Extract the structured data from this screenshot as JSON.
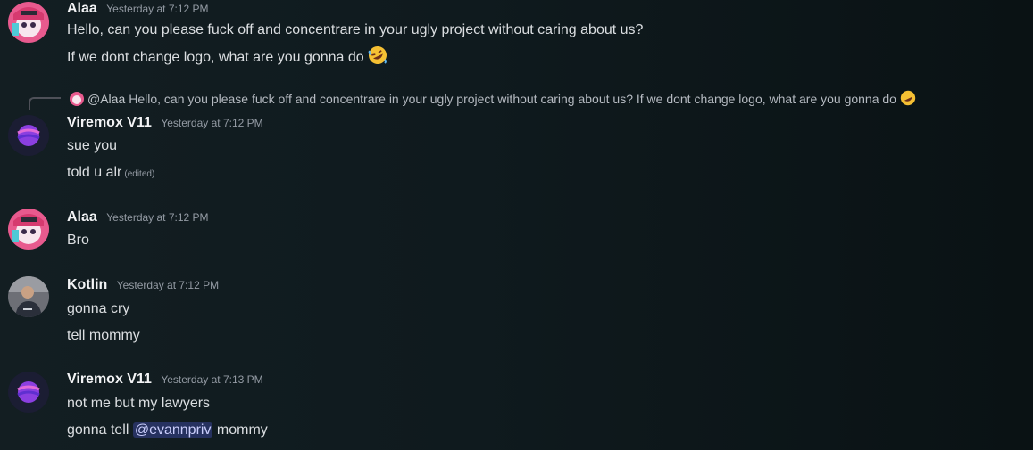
{
  "messages": [
    {
      "author": "Alaa",
      "timestamp": "Yesterday at 7:12 PM",
      "avatar": "anime-girl-avatar",
      "lines": [
        "Hello, can you please fuck off and concentrare in your ugly project without caring about us?",
        "If we dont change logo, what are you gonna do"
      ],
      "emoji": "rofl-emoji"
    },
    {
      "reply": {
        "mention": "@Alaa",
        "text": "Hello, can you please fuck off and concentrare in your ugly project without caring about us? If we dont change logo, what are you gonna do"
      },
      "author": "Viremox V11",
      "timestamp": "Yesterday at 7:12 PM",
      "avatar": "purple-planet-avatar",
      "lines": [
        "sue you",
        "told u alr"
      ],
      "edited": "(edited)"
    },
    {
      "author": "Alaa",
      "timestamp": "Yesterday at 7:12 PM",
      "avatar": "anime-girl-avatar",
      "lines": [
        "Bro"
      ]
    },
    {
      "author": "Kotlin",
      "timestamp": "Yesterday at 7:12 PM",
      "avatar": "photo-avatar",
      "lines": [
        "gonna cry",
        "tell mommy"
      ]
    },
    {
      "author": "Viremox V11",
      "timestamp": "Yesterday at 7:13 PM",
      "avatar": "purple-planet-avatar",
      "lines": [
        "not me but my lawyers"
      ],
      "line2": {
        "before": "gonna tell ",
        "mention": "@evannpriv",
        "after": " mommy"
      }
    }
  ],
  "colors": {
    "mention_bg": "#3a3f79",
    "mention_text": "#c9cdfb",
    "timestamp": "#949ba4"
  }
}
